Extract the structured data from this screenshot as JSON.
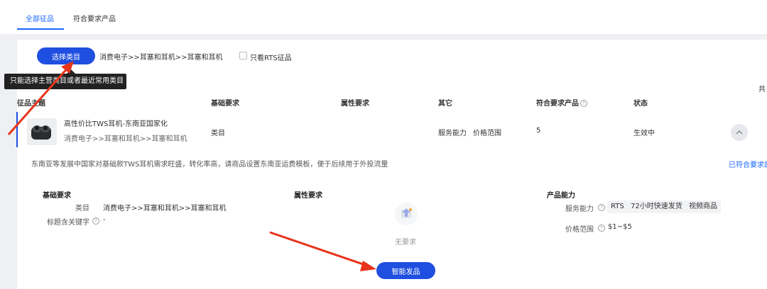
{
  "tabs": [
    {
      "label": "全部征品",
      "active": true
    },
    {
      "label": "符合要求产品",
      "active": false
    }
  ],
  "filter": {
    "select_button": "选择类目",
    "category_path": "消费电子>>耳塞和耳机>>耳塞和耳机",
    "rts_only_label": "只看RTS征品",
    "rts_only_checked": false
  },
  "tooltip": "只能选择主营类目或者最近常用类目",
  "total_partial": "共",
  "table": {
    "headers": [
      "征品主题",
      "基础要求",
      "属性要求",
      "其它",
      "符合要求产品",
      "状态"
    ],
    "row": {
      "title": "高性价比TWS耳机-东南亚国家化",
      "category": "消费电子>>耳塞和耳机>>耳塞和耳机",
      "basic": "类目",
      "other_1": "服务能力",
      "other_2": "价格范围",
      "matching_count": "5",
      "status": "生效中"
    }
  },
  "detail": {
    "description": "东南亚等发展中国家对基础款TWS耳机需求旺盛，转化率高，请商品设置东南亚运费模板，便于后续用于外投流量",
    "link_partial": "已符合要求的",
    "basic_card": {
      "title": "基础要求",
      "category_label": "类目",
      "category_value": "消费电子>>耳塞和耳机>>耳塞和耳机",
      "keyword_label": "标题含关键字",
      "keyword_value": "-"
    },
    "attr_card": {
      "title": "属性要求",
      "empty_text": "无要求"
    },
    "capability_card": {
      "title": "产品能力",
      "service_label": "服务能力",
      "service_tags": [
        "RTS",
        "72小时快速发货",
        "视频商品"
      ],
      "price_label": "价格范围",
      "price_value": "$1~$5"
    }
  },
  "smart_publish_button": "智能发品",
  "colors": {
    "primary": "#1f4fe0",
    "link": "#1966ff",
    "annotation_arrow": "#e8341c"
  },
  "icons": [
    "help-icon",
    "chevron-up-icon",
    "empty-box-icon",
    "earbuds-product-image"
  ]
}
